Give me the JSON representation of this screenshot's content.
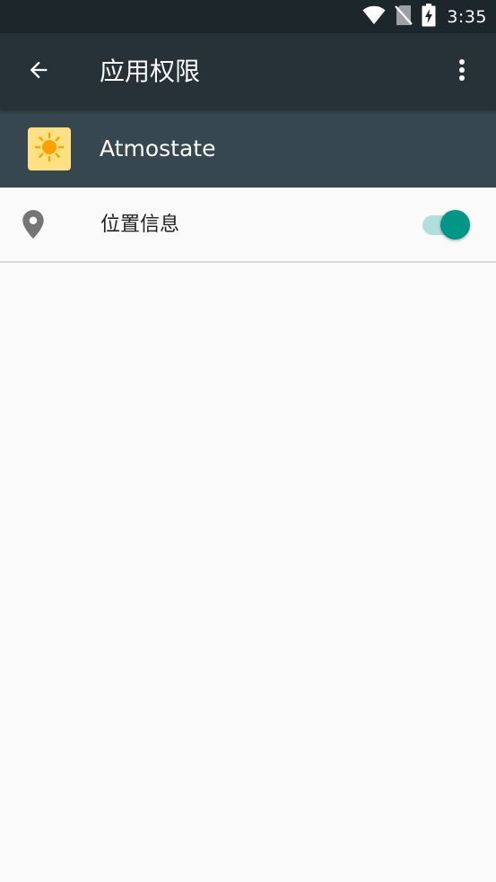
{
  "status_bar": {
    "time": "3:35",
    "icons": [
      "wifi-icon",
      "no-sim-icon",
      "battery-charging-icon"
    ]
  },
  "app_bar": {
    "title": "应用权限",
    "back_icon": "arrow-back-icon",
    "overflow_icon": "more-vert-icon"
  },
  "app_header": {
    "app_name": "Atmostate",
    "icon": "sun-icon"
  },
  "permissions": [
    {
      "label": "位置信息",
      "icon": "location-pin-icon",
      "enabled": true
    }
  ],
  "colors": {
    "status_bar": "#1d262b",
    "app_bar": "#263238",
    "app_header": "#37474f",
    "accent": "#009688",
    "accent_light": "#b2dfdb",
    "app_icon_bg": "#ffe082",
    "sun": "#ffa000",
    "background": "#fafafa"
  }
}
